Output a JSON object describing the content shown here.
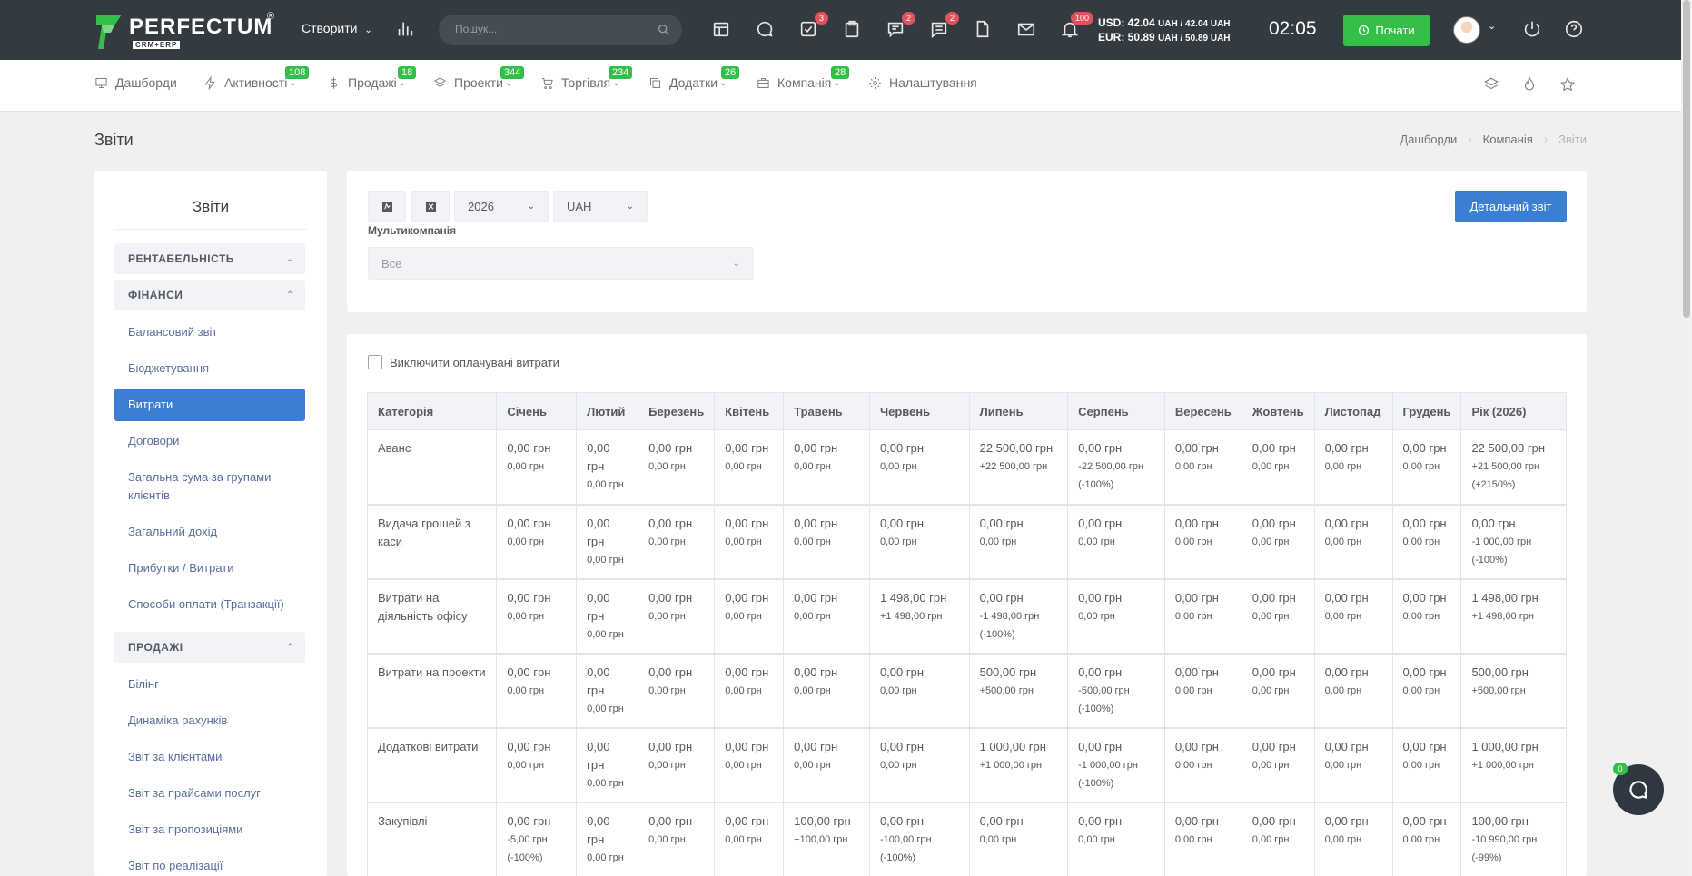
{
  "topbar": {
    "logo_text": "PERFECTUM",
    "logo_reg": "®",
    "logo_sub": "CRM+ERP",
    "create_label": "Створити",
    "search_placeholder": "Пошук...",
    "badges": {
      "tasks": "3",
      "discussions": "2",
      "chat": "2",
      "notifications": "100"
    },
    "rate_usd": "USD: 42.04",
    "rate_usd_units": "UAH / 42.04 UAH",
    "rate_eur": "EUR: 50.89",
    "rate_eur_units": "UAH / 50.89 UAH",
    "clock": "02:05",
    "start_label": "Почати"
  },
  "nav": {
    "items": [
      {
        "label": "Дашборди",
        "badge": ""
      },
      {
        "label": "Активності",
        "badge": "108"
      },
      {
        "label": "Продажі",
        "badge": "18"
      },
      {
        "label": "Проекти",
        "badge": "344"
      },
      {
        "label": "Торгівля",
        "badge": "234"
      },
      {
        "label": "Додатки",
        "badge": "26"
      },
      {
        "label": "Компанія",
        "badge": "28"
      },
      {
        "label": "Налаштування",
        "badge": ""
      }
    ]
  },
  "page": {
    "title": "Звіти",
    "breadcrumb": [
      "Дашборди",
      "Компанія",
      "Звіти"
    ]
  },
  "sidebar": {
    "title": "Звіти",
    "groups": [
      "РЕНТАБЕЛЬНІСТЬ",
      "ФІНАНСИ",
      "ПРОДАЖІ"
    ],
    "finance_items": [
      "Балансовий звіт",
      "Бюджетування",
      "Витрати",
      "Договори",
      "Загальна сума за групами клієнтів",
      "Загальний дохід",
      "Прибутки / Витрати",
      "Способи оплати (Транзакції)"
    ],
    "sales_items": [
      "Білінг",
      "Динаміка рахунків",
      "Звіт за клієнтами",
      "Звіт за прайсами послуг",
      "Звіт за пропозиціями",
      "Звіт по реалізації"
    ]
  },
  "filters": {
    "year": "2026",
    "currency": "UAH",
    "multi_label": "Мультикомпанія",
    "multi_value": "Все",
    "detail_button": "Детальний звіт"
  },
  "report": {
    "checkbox_label": "Виключити оплачувані витрати",
    "columns": [
      "Категорія",
      "Січень",
      "Лютий",
      "Березень",
      "Квітень",
      "Травень",
      "Червень",
      "Липень",
      "Серпень",
      "Вересень",
      "Жовтень",
      "Листопад",
      "Грудень",
      "Рік (2026)"
    ],
    "rows": [
      {
        "category": "Аванс",
        "cells": [
          [
            "0,00 грн",
            "0,00 грн",
            ""
          ],
          [
            "0,00 грн",
            "0,00 грн",
            ""
          ],
          [
            "0,00 грн",
            "0,00 грн",
            ""
          ],
          [
            "0,00 грн",
            "0,00 грн",
            ""
          ],
          [
            "0,00 грн",
            "0,00 грн",
            ""
          ],
          [
            "0,00 грн",
            "0,00 грн",
            ""
          ],
          [
            "22 500,00 грн",
            "+22 500,00 грн",
            ""
          ],
          [
            "0,00 грн",
            "-22 500,00 грн",
            "(-100%)"
          ],
          [
            "0,00 грн",
            "0,00 грн",
            ""
          ],
          [
            "0,00 грн",
            "0,00 грн",
            ""
          ],
          [
            "0,00 грн",
            "0,00 грн",
            ""
          ],
          [
            "0,00 грн",
            "0,00 грн",
            ""
          ],
          [
            "22 500,00 грн",
            "+21 500,00 грн",
            "(+2150%)"
          ]
        ]
      },
      {
        "category": "Видача грошей з каси",
        "cells": [
          [
            "0,00 грн",
            "0,00 грн",
            ""
          ],
          [
            "0,00 грн",
            "0,00 грн",
            ""
          ],
          [
            "0,00 грн",
            "0,00 грн",
            ""
          ],
          [
            "0,00 грн",
            "0,00 грн",
            ""
          ],
          [
            "0,00 грн",
            "0,00 грн",
            ""
          ],
          [
            "0,00 грн",
            "0,00 грн",
            ""
          ],
          [
            "0,00 грн",
            "0,00 грн",
            ""
          ],
          [
            "0,00 грн",
            "0,00 грн",
            ""
          ],
          [
            "0,00 грн",
            "0,00 грн",
            ""
          ],
          [
            "0,00 грн",
            "0,00 грн",
            ""
          ],
          [
            "0,00 грн",
            "0,00 грн",
            ""
          ],
          [
            "0,00 грн",
            "0,00 грн",
            ""
          ],
          [
            "0,00 грн",
            "-1 000,00 грн",
            "(-100%)"
          ]
        ]
      },
      {
        "category": "Витрати на діяльність офісу",
        "cells": [
          [
            "0,00 грн",
            "0,00 грн",
            ""
          ],
          [
            "0,00 грн",
            "0,00 грн",
            ""
          ],
          [
            "0,00 грн",
            "0,00 грн",
            ""
          ],
          [
            "0,00 грн",
            "0,00 грн",
            ""
          ],
          [
            "0,00 грн",
            "0,00 грн",
            ""
          ],
          [
            "1 498,00 грн",
            "+1 498,00 грн",
            ""
          ],
          [
            "0,00 грн",
            "-1 498,00 грн",
            "(-100%)"
          ],
          [
            "0,00 грн",
            "0,00 грн",
            ""
          ],
          [
            "0,00 грн",
            "0,00 грн",
            ""
          ],
          [
            "0,00 грн",
            "0,00 грн",
            ""
          ],
          [
            "0,00 грн",
            "0,00 грн",
            ""
          ],
          [
            "0,00 грн",
            "0,00 грн",
            ""
          ],
          [
            "1 498,00 грн",
            "+1 498,00 грн",
            ""
          ]
        ]
      },
      {
        "category": "Витрати на проекти",
        "cells": [
          [
            "0,00 грн",
            "0,00 грн",
            ""
          ],
          [
            "0,00 грн",
            "0,00 грн",
            ""
          ],
          [
            "0,00 грн",
            "0,00 грн",
            ""
          ],
          [
            "0,00 грн",
            "0,00 грн",
            ""
          ],
          [
            "0,00 грн",
            "0,00 грн",
            ""
          ],
          [
            "0,00 грн",
            "0,00 грн",
            ""
          ],
          [
            "500,00 грн",
            "+500,00 грн",
            ""
          ],
          [
            "0,00 грн",
            "-500,00 грн",
            "(-100%)"
          ],
          [
            "0,00 грн",
            "0,00 грн",
            ""
          ],
          [
            "0,00 грн",
            "0,00 грн",
            ""
          ],
          [
            "0,00 грн",
            "0,00 грн",
            ""
          ],
          [
            "0,00 грн",
            "0,00 грн",
            ""
          ],
          [
            "500,00 грн",
            "+500,00 грн",
            ""
          ]
        ]
      },
      {
        "category": "Додаткові витрати",
        "cells": [
          [
            "0,00 грн",
            "0,00 грн",
            ""
          ],
          [
            "0,00 грн",
            "0,00 грн",
            ""
          ],
          [
            "0,00 грн",
            "0,00 грн",
            ""
          ],
          [
            "0,00 грн",
            "0,00 грн",
            ""
          ],
          [
            "0,00 грн",
            "0,00 грн",
            ""
          ],
          [
            "0,00 грн",
            "0,00 грн",
            ""
          ],
          [
            "1 000,00 грн",
            "+1 000,00 грн",
            ""
          ],
          [
            "0,00 грн",
            "-1 000,00 грн",
            "(-100%)"
          ],
          [
            "0,00 грн",
            "0,00 грн",
            ""
          ],
          [
            "0,00 грн",
            "0,00 грн",
            ""
          ],
          [
            "0,00 грн",
            "0,00 грн",
            ""
          ],
          [
            "0,00 грн",
            "0,00 грн",
            ""
          ],
          [
            "1 000,00 грн",
            "+1 000,00 грн",
            ""
          ]
        ]
      },
      {
        "category": "Закупівлі",
        "cells": [
          [
            "0,00 грн",
            "-5,00 грн",
            "(-100%)"
          ],
          [
            "0,00 грн",
            "0,00 грн",
            ""
          ],
          [
            "0,00 грн",
            "0,00 грн",
            ""
          ],
          [
            "0,00 грн",
            "0,00 грн",
            ""
          ],
          [
            "100,00 грн",
            "+100,00 грн",
            ""
          ],
          [
            "0,00 грн",
            "-100,00 грн",
            "(-100%)"
          ],
          [
            "0,00 грн",
            "0,00 грн",
            ""
          ],
          [
            "0,00 грн",
            "0,00 грн",
            ""
          ],
          [
            "0,00 грн",
            "0,00 грн",
            ""
          ],
          [
            "0,00 грн",
            "0,00 грн",
            ""
          ],
          [
            "0,00 грн",
            "0,00 грн",
            ""
          ],
          [
            "0,00 грн",
            "0,00 грн",
            ""
          ],
          [
            "100,00 грн",
            "-10 990,00 грн",
            "(-99%)"
          ]
        ]
      }
    ]
  },
  "chat": {
    "badge": "0"
  },
  "colors": {
    "topbar": "#333a40",
    "accent": "#3b7fd4",
    "green": "#34bf49",
    "badge_red": "#e2525c"
  }
}
